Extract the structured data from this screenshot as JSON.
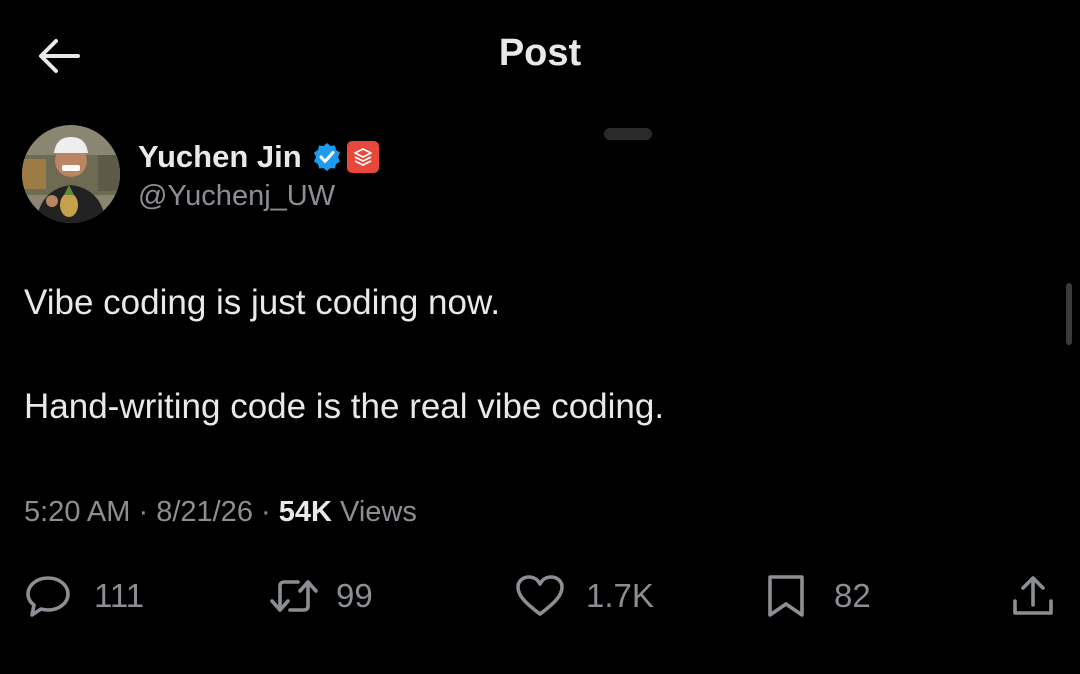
{
  "header": {
    "title": "Post",
    "back_icon": "arrow-left-icon"
  },
  "author": {
    "display_name": "Yuchen Jin",
    "handle": "@Yuchenj_UW",
    "verified_icon": "verified-badge-icon",
    "affiliation_icon": "affiliate-badge-icon",
    "verified_color": "#1d9bf0",
    "affiliation_color": "#e8483a"
  },
  "post": {
    "line1": "Vibe coding is just coding now.",
    "line2": "Hand-writing code is the real vibe coding."
  },
  "meta": {
    "time": "5:20 AM",
    "sep1": " · ",
    "date": "8/21/26",
    "sep2": " · ",
    "views_count": "54K",
    "views_label": " Views"
  },
  "actions": {
    "replies": "111",
    "reposts": "99",
    "likes": "1.7K",
    "bookmarks": "82"
  },
  "colors": {
    "background": "#000000",
    "text": "#e7e9ea",
    "muted": "#8b8f94"
  }
}
